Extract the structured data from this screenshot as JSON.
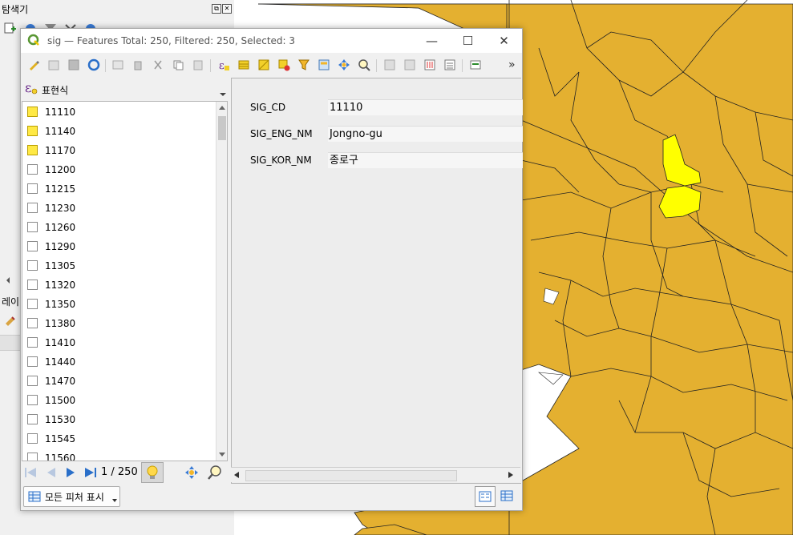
{
  "browser": {
    "title": "탐색기",
    "layers_title": "레이"
  },
  "dialog": {
    "title": "sig — Features Total: 250, Filtered: 250, Selected: 3",
    "minimize_glyph": "—",
    "maximize_glyph": "☐",
    "close_glyph": "✕",
    "overflow_glyph": "»",
    "expression_label": "표현식",
    "features": [
      {
        "id": "11110",
        "selected": true
      },
      {
        "id": "11140",
        "selected": true
      },
      {
        "id": "11170",
        "selected": true
      },
      {
        "id": "11200",
        "selected": false
      },
      {
        "id": "11215",
        "selected": false
      },
      {
        "id": "11230",
        "selected": false
      },
      {
        "id": "11260",
        "selected": false
      },
      {
        "id": "11290",
        "selected": false
      },
      {
        "id": "11305",
        "selected": false
      },
      {
        "id": "11320",
        "selected": false
      },
      {
        "id": "11350",
        "selected": false
      },
      {
        "id": "11380",
        "selected": false
      },
      {
        "id": "11410",
        "selected": false
      },
      {
        "id": "11440",
        "selected": false
      },
      {
        "id": "11470",
        "selected": false
      },
      {
        "id": "11500",
        "selected": false
      },
      {
        "id": "11530",
        "selected": false
      },
      {
        "id": "11545",
        "selected": false
      },
      {
        "id": "11560",
        "selected": false
      }
    ],
    "pager": "1 / 250",
    "show_all_label": "모든 피처 표시",
    "form": [
      {
        "label": "SIG_CD",
        "value": "11110"
      },
      {
        "label": "SIG_ENG_NM",
        "value": "Jongno-gu"
      },
      {
        "label": "SIG_KOR_NM",
        "value": "종로구"
      }
    ]
  },
  "colors": {
    "map_fill": "#e4b030",
    "selected_fill": "#ffff00",
    "selection_checkbox": "#ffe944",
    "qgis_green": "#589632"
  }
}
